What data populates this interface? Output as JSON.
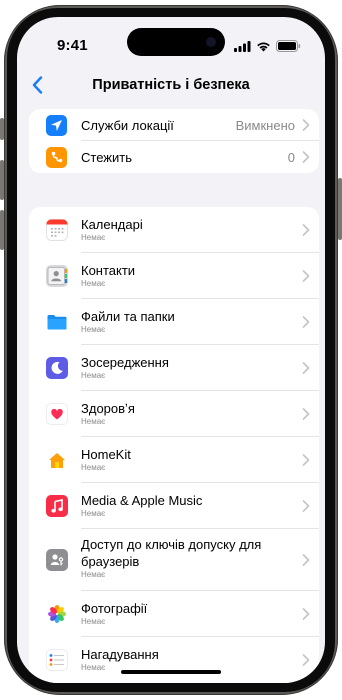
{
  "status_bar": {
    "time": "9:41"
  },
  "nav": {
    "title": "Приватність і безпека",
    "back_icon": "chevron-left-icon"
  },
  "top_group": [
    {
      "icon": "location-arrow-icon",
      "icon_bg": "#147efb",
      "label": "Служби локації",
      "value": "Вимкнено"
    },
    {
      "icon": "tracking-icon",
      "icon_bg": "#ff9500",
      "label": "Стежить",
      "value": "0"
    }
  ],
  "apps": [
    {
      "icon": "calendar-icon",
      "title": "Календарі",
      "sub": "Немає"
    },
    {
      "icon": "contacts-icon",
      "title": "Контакти",
      "sub": "Немає"
    },
    {
      "icon": "files-folder-icon",
      "title": "Файли та папки",
      "sub": "Немає"
    },
    {
      "icon": "focus-moon-icon",
      "title": "Зосередження",
      "sub": "Немає"
    },
    {
      "icon": "health-heart-icon",
      "title": "Здоровʼя",
      "sub": "Немає"
    },
    {
      "icon": "homekit-house-icon",
      "title": "HomeKit",
      "sub": "Немає"
    },
    {
      "icon": "music-note-icon",
      "title": "Media & Apple Music",
      "sub": "Немає"
    },
    {
      "icon": "passkey-access-icon",
      "title": "Доступ до ключів допуску для браузерів",
      "sub": "Немає"
    },
    {
      "icon": "photos-flower-icon",
      "title": "Фотографії",
      "sub": "Немає"
    },
    {
      "icon": "reminders-list-icon",
      "title": "Нагадування",
      "sub": "Немає"
    }
  ],
  "colors": {
    "accent": "#147efb",
    "background": "#f2f2f7",
    "secondary_text": "#8a8a8e"
  }
}
